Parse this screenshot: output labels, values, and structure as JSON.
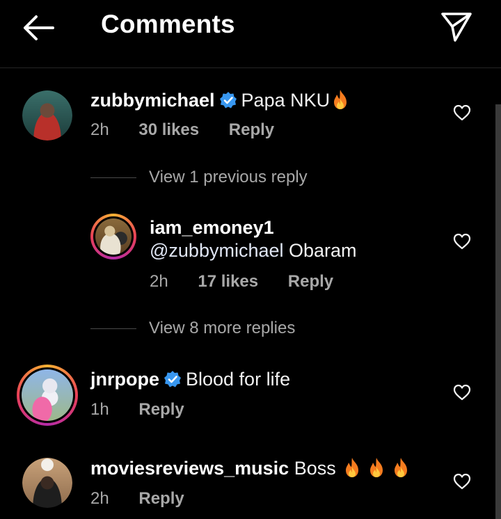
{
  "header": {
    "title": "Comments"
  },
  "comments": [
    {
      "username": "zubbymichael",
      "verified": true,
      "text": "Papa NKU",
      "time": "2h",
      "likes": "30 likes",
      "reply": "Reply"
    },
    {
      "username": "iam_emoney1",
      "verified": false,
      "mention": "@zubbymichael",
      "text": "Obaram",
      "time": "2h",
      "likes": "17 likes",
      "reply": "Reply"
    },
    {
      "username": "jnrpope",
      "verified": true,
      "text": "Blood for life",
      "time": "1h",
      "reply": "Reply"
    },
    {
      "username": "moviesreviews_music",
      "verified": false,
      "text": "Boss",
      "time": "2h",
      "reply": "Reply"
    }
  ],
  "threads": {
    "previous_replies": "View 1 previous reply",
    "more_replies": "View 8 more replies"
  },
  "colors": {
    "background": "#000000",
    "secondary_text": "#a8a8a8",
    "verified_badge": "#3897f0",
    "story_ring": "#e94057"
  },
  "icons": [
    "back-arrow-icon",
    "send-icon",
    "verified-icon",
    "fire-icon",
    "heart-icon"
  ]
}
